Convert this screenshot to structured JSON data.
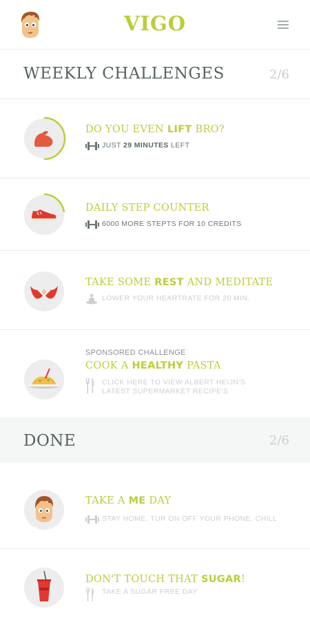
{
  "app": {
    "logo": "VIGO"
  },
  "weekly": {
    "title": "WEEKLY CHALLENGES",
    "count": "2/6"
  },
  "done": {
    "title": "DONE",
    "count": "2/6"
  },
  "colors": {
    "accent": "#b8cf3c",
    "text": "#5d6a6f",
    "faded": "#cbd0d2",
    "red": "#e03a2e"
  },
  "challenges": [
    {
      "icon": "arm-muscle-icon",
      "title_pre": "DO YOU EVEN ",
      "title_bold": "LIFT",
      "title_post": " BRO?",
      "meta_icon": "dumbbell-icon",
      "meta_pre": "JUST ",
      "meta_bold": "29 MINUTES",
      "meta_post": " LEFT",
      "progress": 0.5
    },
    {
      "icon": "sneaker-icon",
      "title_pre": "DAILY STEP COUNTER",
      "title_bold": "",
      "title_post": "",
      "meta_icon": "dumbbell-icon",
      "meta_pre": "6000 MORE STEPTS FOR 10 CREDITS",
      "meta_bold": "",
      "meta_post": "",
      "progress": 0.3
    },
    {
      "icon": "meditation-hands-icon",
      "title_pre": "TAKE SOME ",
      "title_bold": "REST",
      "title_post": " AND MEDITATE",
      "meta_icon": "meditation-person-icon",
      "meta_pre": "LOWER YOUR HEARTRATE FOR 20 MIN.",
      "meta_bold": "",
      "meta_post": ""
    },
    {
      "sponsored_label": "SPONSORED CHALLENGE",
      "icon": "pasta-plate-icon",
      "title_pre": "COOK A ",
      "title_bold": "HEALTHY",
      "title_post": " PASTA",
      "meta_icon": "fork-knife-icon",
      "meta_pre": "CLICK HERE TO VIEW ALBERT HEIJN'S LATEST SUPERMARKET RECIPE'S",
      "meta_bold": "",
      "meta_post": ""
    }
  ],
  "done_items": [
    {
      "icon": "face-avatar-icon",
      "title_pre": "TAKE A ",
      "title_bold": "ME",
      "title_post": " DAY",
      "meta_icon": "dumbbell-icon",
      "meta_pre": "STAY HOME, TUR ON OFF YOUR PHONE, CHILL",
      "meta_bold": "",
      "meta_post": ""
    },
    {
      "icon": "soda-cup-icon",
      "title_pre": "DON'T TOUCH THAT ",
      "title_bold": "SUGAR",
      "title_post": "!",
      "meta_icon": "fork-knife-icon",
      "meta_pre": "TAKE A SUGAR FREE DAY",
      "meta_bold": "",
      "meta_post": ""
    }
  ]
}
